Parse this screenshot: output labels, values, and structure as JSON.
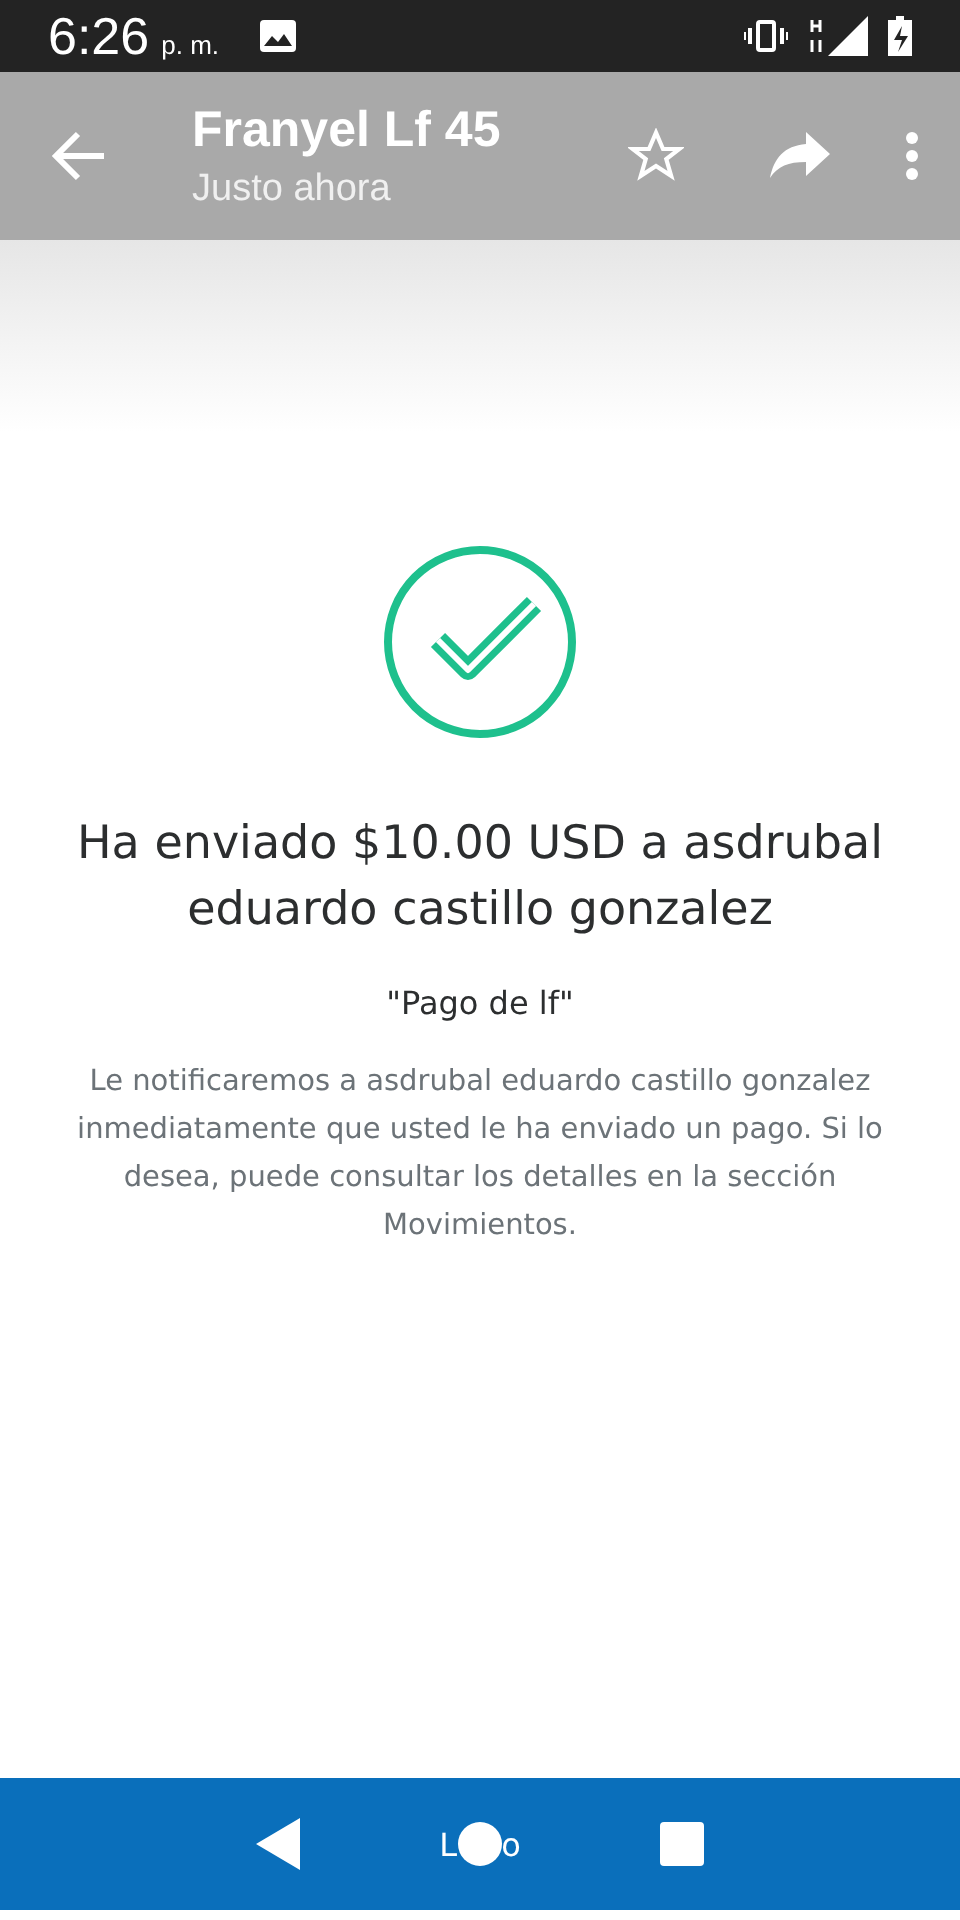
{
  "status_bar": {
    "time": "6:26",
    "ampm": "p. m."
  },
  "app_bar": {
    "title": "Franyel Lf 45",
    "subtitle": "Justo ahora"
  },
  "confirmation": {
    "heading": "Ha enviado $10.00 USD a asdrubal eduardo castillo gonzalez",
    "memo": "\"Pago de lf\"",
    "message": "Le notificaremos a asdrubal eduardo castillo gonzalez inmediatamente que usted le ha enviado un pago. Si lo desea, puede consultar los detalles en la sección Movimientos."
  },
  "bottom_button": {
    "text_before": "L",
    "text_after": "o"
  }
}
